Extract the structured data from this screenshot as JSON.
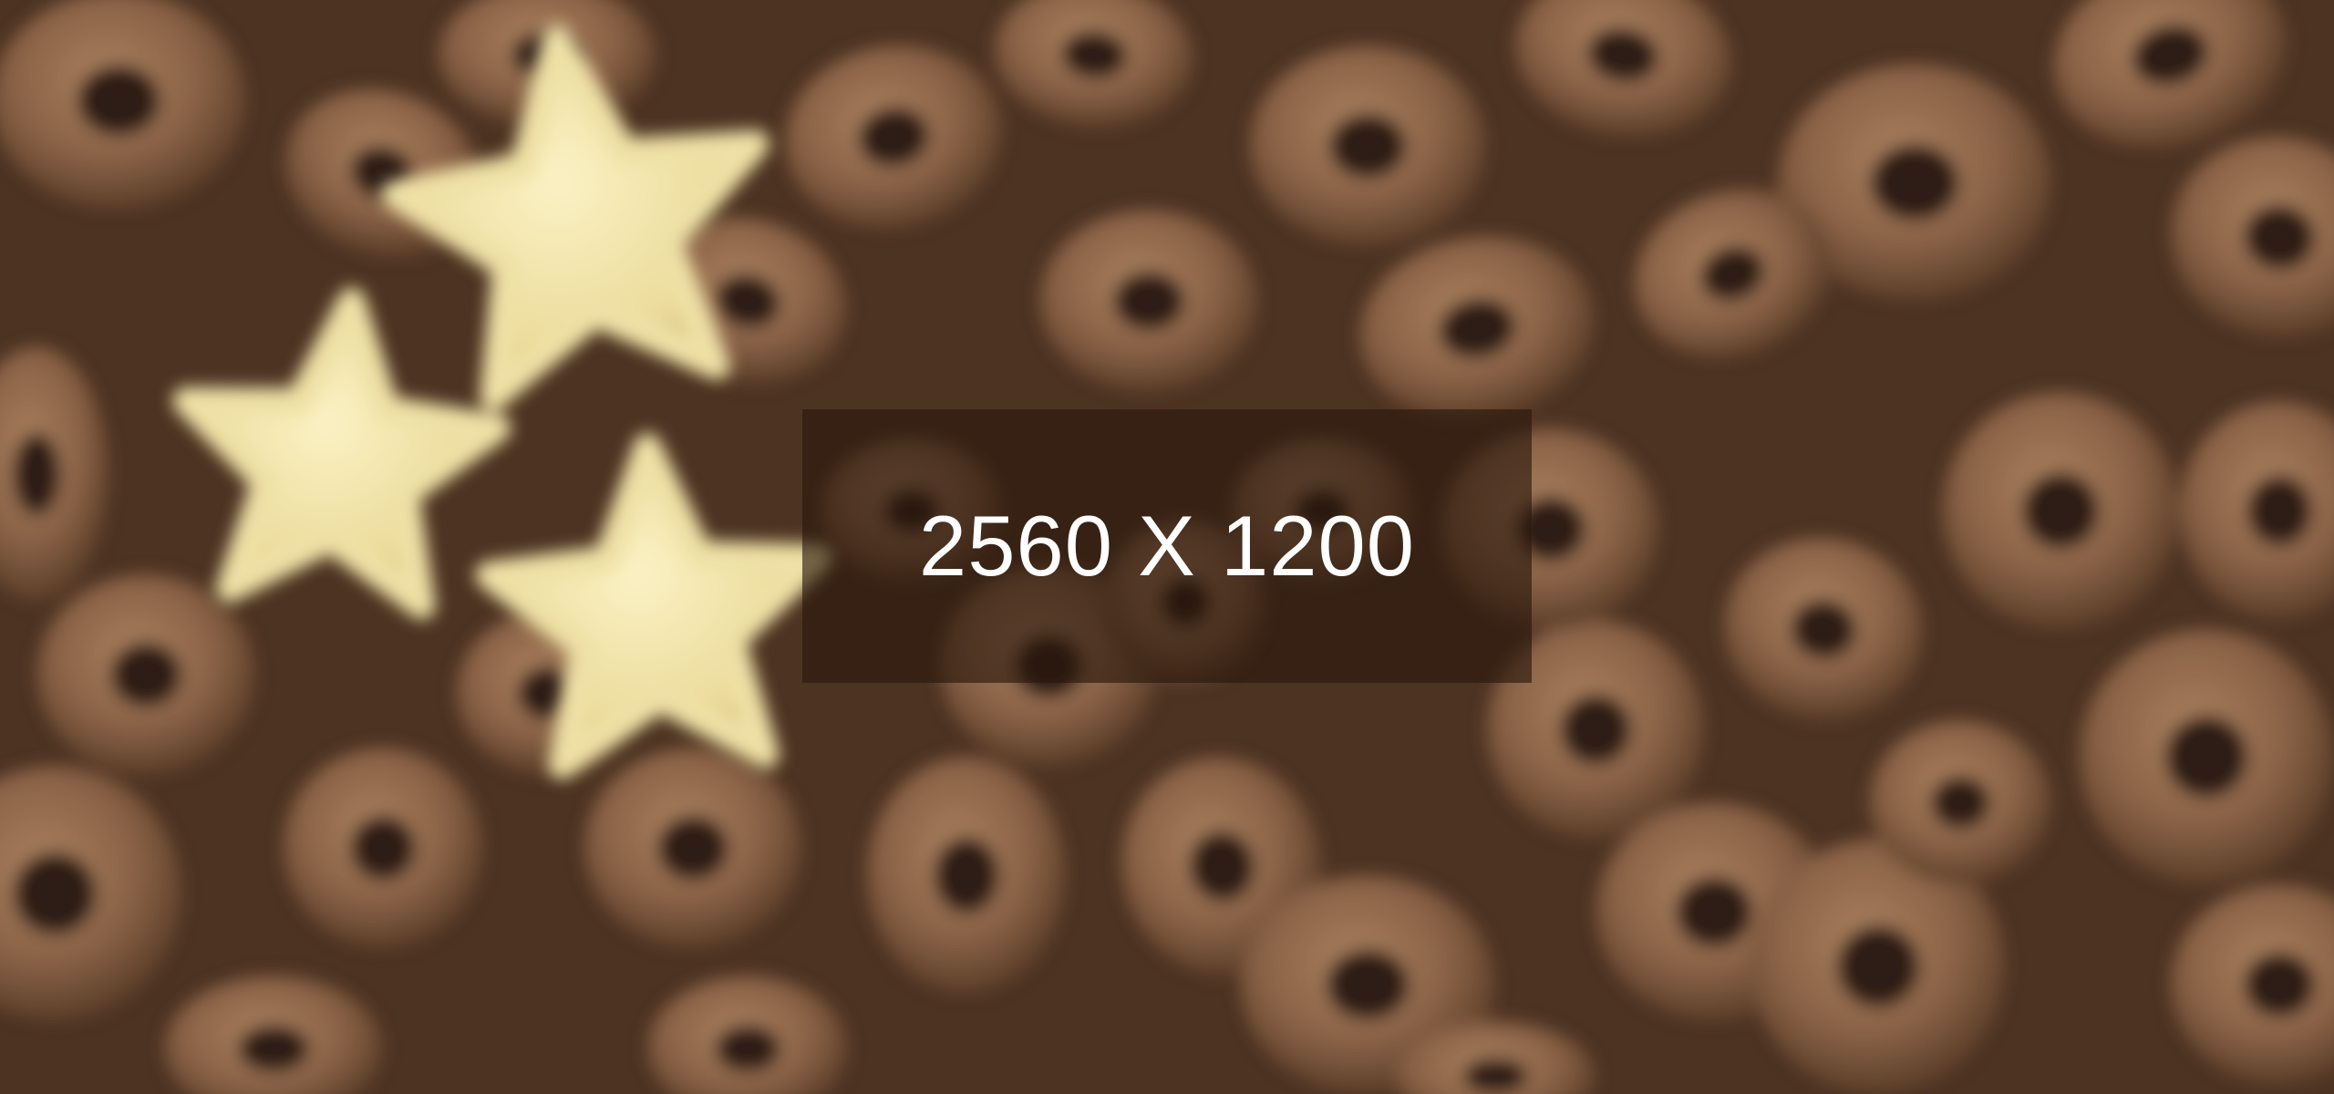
{
  "image": {
    "subject": "chocolate-cereal-rings-and-star-shaped-cereal",
    "palette": {
      "background_dark": "#4a3020",
      "ring_brown": "#8a6246",
      "ring_highlight": "#a27a5c",
      "ring_hole": "#2e1d12",
      "star_cream": "#efe1a6",
      "overlay": "rgba(40, 22, 12, 0.62)",
      "overlay_text": "#ffffff"
    }
  },
  "overlay": {
    "text": "2560 X 1200"
  }
}
